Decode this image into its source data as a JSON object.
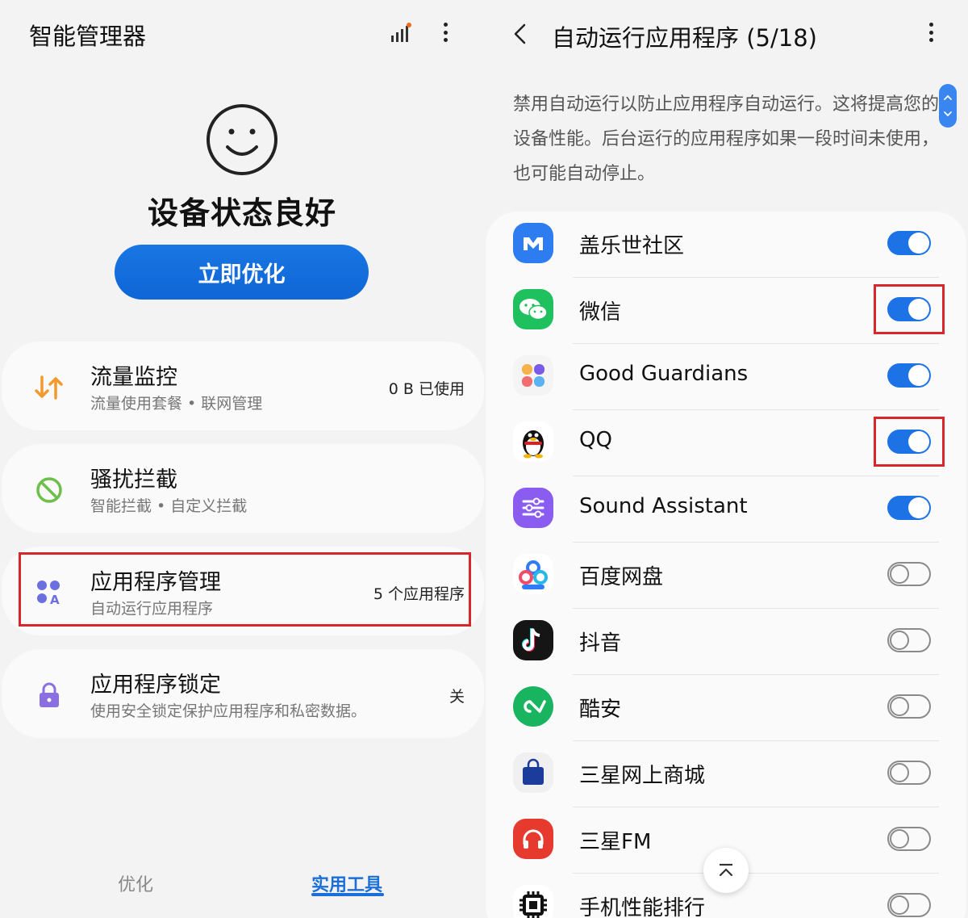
{
  "left": {
    "title": "智能管理器",
    "status": "设备状态良好",
    "optimize_button": "立即优化",
    "cards": [
      {
        "title": "流量监控",
        "subtitle": "流量使用套餐 • 联网管理",
        "value": "0 B 已使用",
        "icon": "data-arrows-icon"
      },
      {
        "title": "骚扰拦截",
        "subtitle": "智能拦截 • 自定义拦截",
        "value": "",
        "icon": "block-icon"
      },
      {
        "title": "应用程序管理",
        "subtitle": "自动运行应用程序",
        "value": "5 个应用程序",
        "icon": "apps-icon"
      },
      {
        "title": "应用程序锁定",
        "subtitle": "使用安全锁定保护应用程序和私密数据。",
        "value": "关",
        "icon": "lock-icon"
      }
    ],
    "tabs": {
      "optimize": "优化",
      "tools": "实用工具"
    }
  },
  "right": {
    "title": "自动运行应用程序 (5/18)",
    "description": "禁用自动运行以防止应用程序自动运行。这将提高您的设备性能。后台运行的应用程序如果一段时间未使用，也可能自动停止。",
    "apps": [
      {
        "name": "盖乐世社区",
        "enabled": true,
        "icon": "samsung-members-icon"
      },
      {
        "name": "微信",
        "enabled": true,
        "icon": "wechat-icon"
      },
      {
        "name": "Good Guardians",
        "enabled": true,
        "icon": "good-guardians-icon"
      },
      {
        "name": "QQ",
        "enabled": true,
        "icon": "qq-penguin-icon"
      },
      {
        "name": "Sound Assistant",
        "enabled": true,
        "icon": "sliders-icon"
      },
      {
        "name": "百度网盘",
        "enabled": false,
        "icon": "baidu-netdisk-icon"
      },
      {
        "name": "抖音",
        "enabled": false,
        "icon": "douyin-icon"
      },
      {
        "name": "酷安",
        "enabled": false,
        "icon": "coolapk-icon"
      },
      {
        "name": "三星网上商城",
        "enabled": false,
        "icon": "shopping-bag-icon"
      },
      {
        "name": "三星FM",
        "enabled": false,
        "icon": "headphones-icon"
      },
      {
        "name": "手机性能排行",
        "enabled": false,
        "icon": "chip-icon"
      }
    ]
  },
  "colors": {
    "accent": "#1d72e6",
    "highlight": "#d9262c"
  }
}
